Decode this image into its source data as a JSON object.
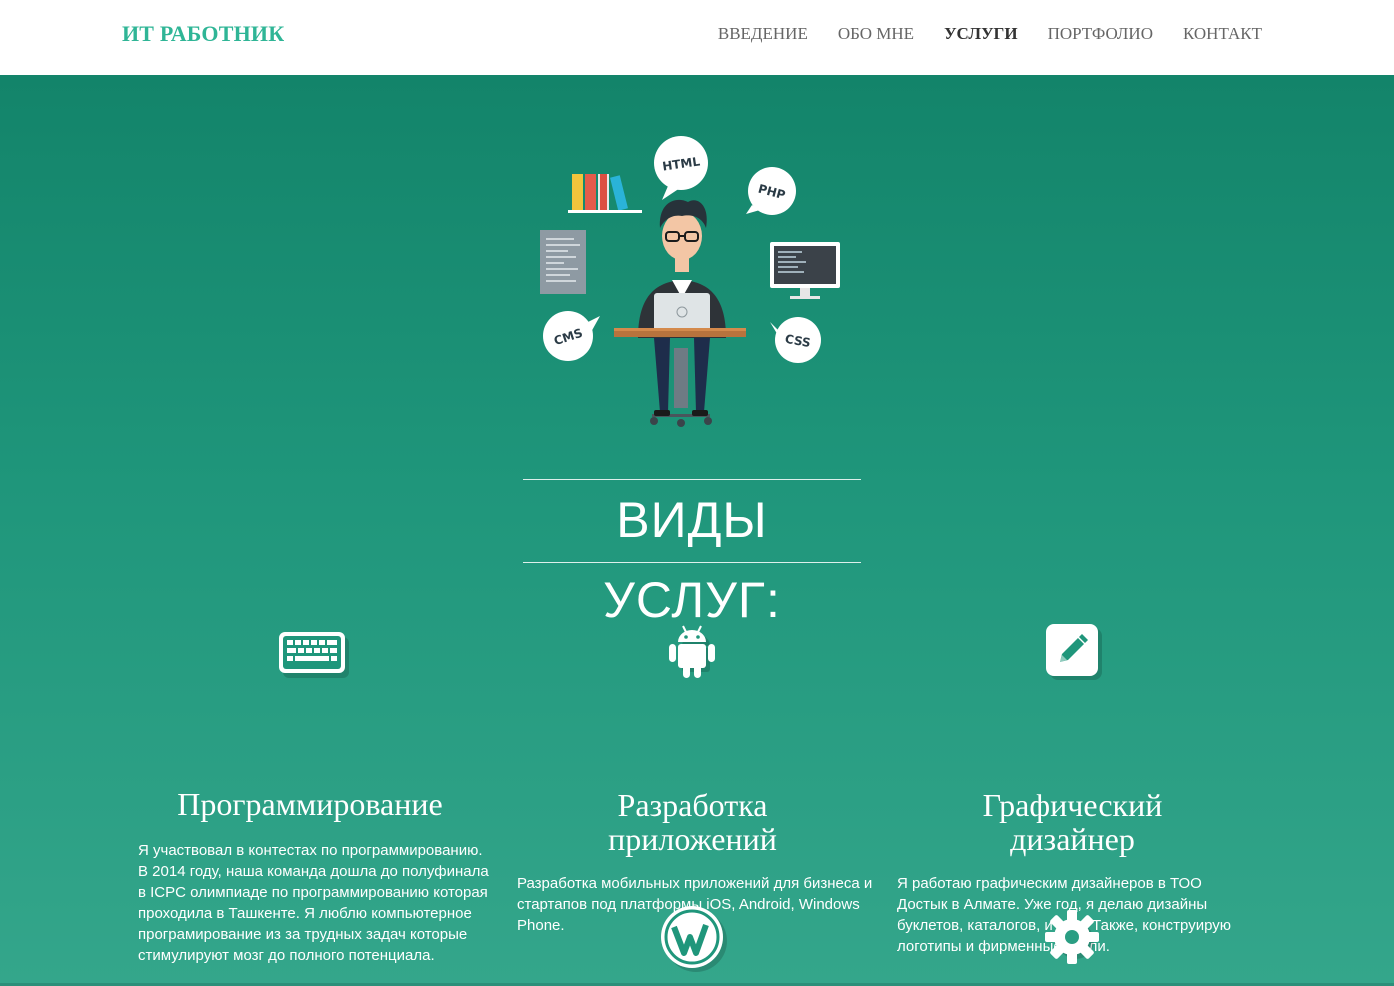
{
  "brand": "ИТ РАБОТНИК",
  "nav": [
    {
      "label": "ВВЕДЕНИЕ"
    },
    {
      "label": "ОБО МНЕ"
    },
    {
      "label": "УСЛУГИ"
    },
    {
      "label": "ПОРТФОЛИО"
    },
    {
      "label": "КОНТАКТ"
    }
  ],
  "active_nav": "УСЛУГИ",
  "illustration": {
    "bubbles": [
      "HTML",
      "PHP",
      "CMS",
      "CSS"
    ]
  },
  "services_title": "ВИДЫ УСЛУГ:",
  "services": [
    {
      "icon": "keyboard-icon",
      "title_lines": [
        "Программирование"
      ],
      "text": "Я участвовал в контестах по программированию. В 2014 году, наша команда дошла до полуфинала в ICPC олимпиаде по программированию которая проходила в Ташкенте. Я люблю компьютерное програмирование из за трудных задач которые стимулируют мозг до полного потенциала."
    },
    {
      "icon": "android-icon",
      "title_lines": [
        "Разработка",
        "приложений"
      ],
      "text": "Разработка мобильных приложений для бизнеса и стартапов под платформы iOS, Android, Windows Phone."
    },
    {
      "icon": "pencil-icon",
      "title_lines": [
        "Графический",
        "дизайнер"
      ],
      "text": "Я работаю графическим дизайнеров в ТОО Достык в Алмате. Уже год, я делаю дизайны буклетов, каталогов, и книг. Также, конструирую логотипы и фирменные стили."
    }
  ],
  "more_service_icons": [
    "wordpress-icon",
    "gear-icon"
  ],
  "colors": {
    "brand": "#2fb596",
    "hero_top": "#13846a",
    "hero_bottom": "#34a68b"
  }
}
